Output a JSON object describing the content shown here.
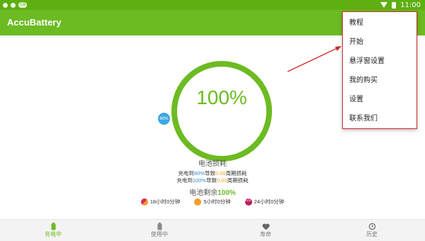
{
  "status_bar": {
    "time": "11:00",
    "left_badge": "CB"
  },
  "app_bar": {
    "title": "AccuBattery"
  },
  "charge": {
    "level": "100%",
    "level_value": 100,
    "alarm_badge": "80%"
  },
  "wear": {
    "title": "电池损耗",
    "line1": {
      "prefix": "充电到",
      "target": "80%",
      "mid": "导致",
      "value": "0.00",
      "suffix": "周期损耗"
    },
    "line2": {
      "prefix": "充电到",
      "target": "100%",
      "mid": "导致",
      "value": "0.00",
      "suffix": "周期损耗"
    }
  },
  "remaining": {
    "label": "电池剩余",
    "value": "100%"
  },
  "estimates": [
    {
      "icon": "screen-on-icon",
      "text": "18小时0分钟"
    },
    {
      "icon": "screen-off-icon",
      "text": "5小时0分钟"
    },
    {
      "icon": "sleep-icon",
      "text": "24小时0分钟",
      "icon_text": "ZZZ"
    }
  ],
  "bottom_nav": [
    {
      "label": "充电中",
      "icon": "battery-charging-icon",
      "active": true
    },
    {
      "label": "使用中",
      "icon": "battery-icon",
      "active": false
    },
    {
      "label": "寿命",
      "icon": "heart-icon",
      "active": false
    },
    {
      "label": "历史",
      "icon": "history-icon",
      "active": false
    }
  ],
  "menu": {
    "items": [
      "教程",
      "开始",
      "悬浮窗设置",
      "我的购买",
      "设置",
      "联系我们"
    ]
  },
  "colors": {
    "accent": "#6cbb22",
    "status_bar": "#5fae12",
    "annotation": "#d12a2a"
  }
}
